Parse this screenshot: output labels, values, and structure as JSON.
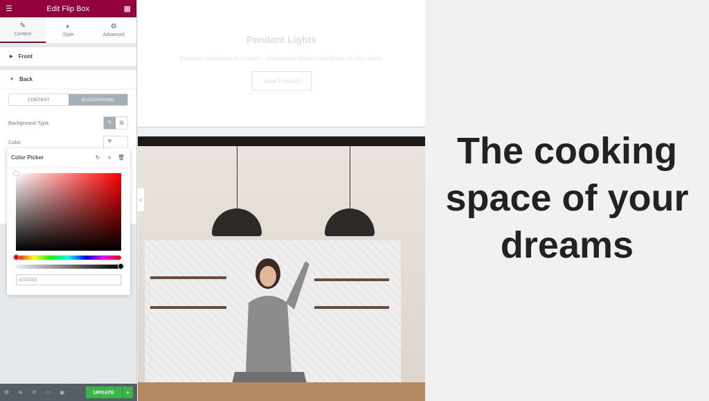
{
  "colors": {
    "brand": "#93003c",
    "update": "#39b54a",
    "active": "#a4afb7"
  },
  "panel": {
    "title": "Edit Flip Box",
    "tabs": [
      {
        "label": "Content",
        "icon": "pencil-icon"
      },
      {
        "label": "Style",
        "icon": "half-circle-icon"
      },
      {
        "label": "Advanced",
        "icon": "gear-icon"
      }
    ],
    "sections": {
      "front": "Front",
      "back": "Back"
    },
    "segment": {
      "content": "CONTENT",
      "background": "BACKGROUND"
    },
    "background_type_label": "Background Type",
    "color_label": "Color",
    "picker": {
      "title": "Color Picker",
      "hex": "#FFFFFF"
    },
    "footer": {
      "update": "UPDATE"
    }
  },
  "card": {
    "title": "Pendant Lights",
    "description": "Pendant lampshade in modern - minimalistic design to brighten up your space",
    "button": "View Product"
  },
  "hero": {
    "line1": "The cooking",
    "line2": "space of your",
    "line3": "dreams"
  }
}
